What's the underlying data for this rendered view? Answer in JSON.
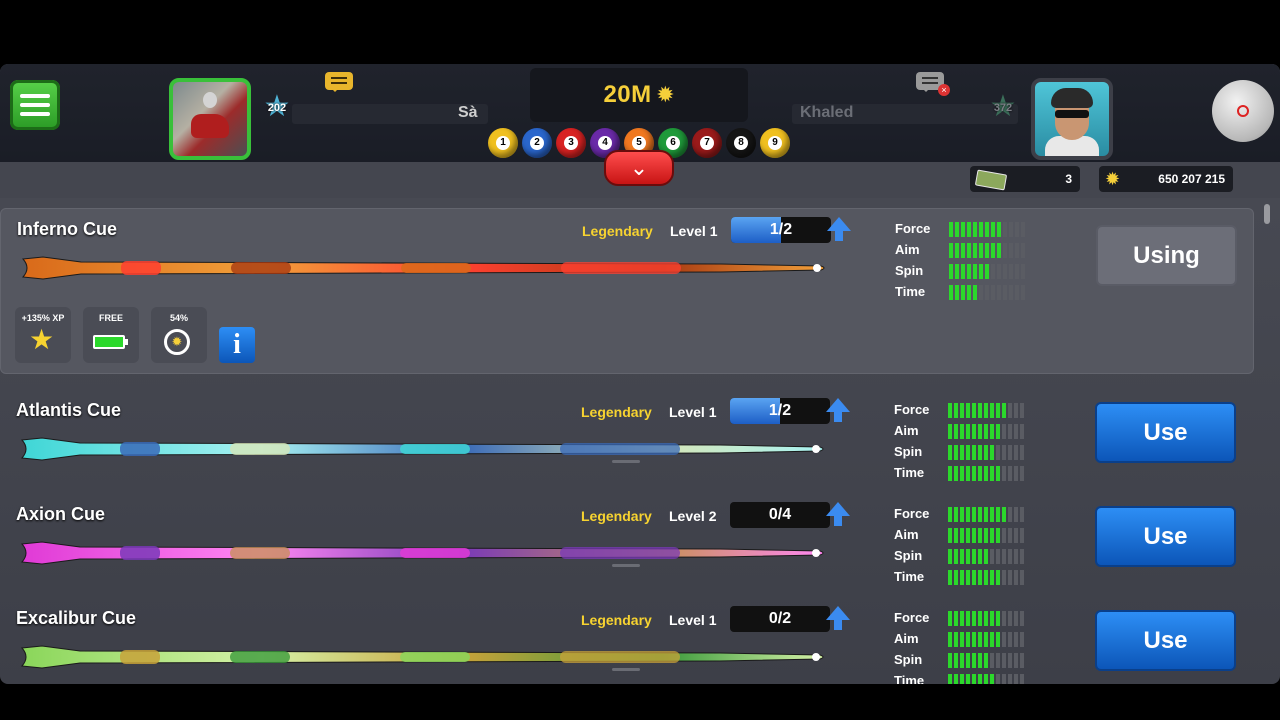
{
  "hud": {
    "player1": {
      "level": "202",
      "name": "Sà"
    },
    "player2": {
      "level": "372",
      "name": "Khaled"
    },
    "pot": "20M",
    "balls": [
      {
        "num": "1",
        "color": "#f0c020"
      },
      {
        "num": "2",
        "color": "#2a66cc"
      },
      {
        "num": "3",
        "color": "#d82222"
      },
      {
        "num": "4",
        "color": "#6a2aa8"
      },
      {
        "num": "5",
        "color": "#f07820"
      },
      {
        "num": "6",
        "color": "#1f9a3a"
      },
      {
        "num": "7",
        "color": "#9a1a1a"
      },
      {
        "num": "8",
        "color": "#151515"
      },
      {
        "num": "9",
        "color": "#f0c020"
      }
    ]
  },
  "currency": {
    "cash": "3",
    "coins": "650 207 215"
  },
  "cues": [
    {
      "name": "Inferno Cue",
      "rarity": "Legendary",
      "level": "Level 1",
      "progress": "1/2",
      "progress_fraction": 0.5,
      "button": "Using",
      "in_use": true,
      "stats": {
        "Force": 9,
        "Aim": 9,
        "Spin": 7,
        "Time": 5
      },
      "colors": [
        "#d96a1a",
        "#f2a03a",
        "#ff4030",
        "#a83a12"
      ],
      "badges": {
        "xp": "+135% XP",
        "free": "FREE",
        "recharge": "54%"
      }
    },
    {
      "name": "Atlantis Cue",
      "rarity": "Legendary",
      "level": "Level 1",
      "progress": "1/2",
      "progress_fraction": 0.5,
      "button": "Use",
      "in_use": false,
      "stats": {
        "Force": 10,
        "Aim": 9,
        "Spin": 8,
        "Time": 9
      },
      "colors": [
        "#3fd6d6",
        "#a8f2f2",
        "#3a6ab8",
        "#d6e6b8"
      ]
    },
    {
      "name": "Axion Cue",
      "rarity": "Legendary",
      "level": "Level 2",
      "progress": "0/4",
      "progress_fraction": 0,
      "button": "Use",
      "in_use": false,
      "stats": {
        "Force": 10,
        "Aim": 9,
        "Spin": 7,
        "Time": 9
      },
      "colors": [
        "#e03ad6",
        "#ff88f2",
        "#7a3ab8",
        "#c8905a"
      ]
    },
    {
      "name": "Excalibur Cue",
      "rarity": "Legendary",
      "level": "Level 1",
      "progress": "0/2",
      "progress_fraction": 0,
      "button": "Use",
      "in_use": false,
      "stats": {
        "Force": 9,
        "Aim": 9,
        "Spin": 7,
        "Time": 8
      },
      "colors": [
        "#8ad65a",
        "#d6f2a8",
        "#c8a23a",
        "#3a9a3a"
      ]
    }
  ],
  "stat_labels": [
    "Force",
    "Aim",
    "Spin",
    "Time"
  ]
}
